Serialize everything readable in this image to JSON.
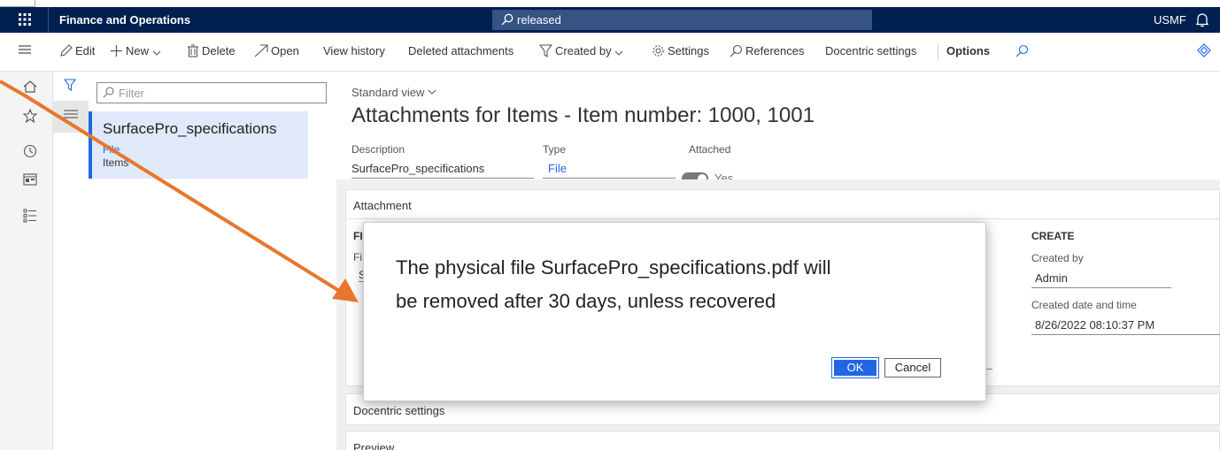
{
  "topbar": {
    "app_title": "Finance and Operations",
    "search_text": "released",
    "company": "USMF"
  },
  "actionbar": {
    "edit": "Edit",
    "new": "New",
    "delete": "Delete",
    "open": "Open",
    "view_history": "View history",
    "deleted_attachments": "Deleted attachments",
    "created_by": "Created by",
    "settings": "Settings",
    "references": "References",
    "docentric_settings": "Docentric settings",
    "options": "Options"
  },
  "list": {
    "filter_placeholder": "Filter",
    "items": [
      {
        "title": "SurfacePro_specifications",
        "type": "File",
        "table": "Items"
      }
    ]
  },
  "main": {
    "view_name": "Standard view",
    "page_title": "Attachments for Items - Item number: 1000, 1001",
    "fields": {
      "description_label": "Description",
      "description_value": "SurfacePro_specifications",
      "type_label": "Type",
      "type_value": "File",
      "attached_label": "Attached",
      "attached_value": "Yes"
    },
    "sections": {
      "attachment": "Attachment",
      "docentric": "Docentric settings",
      "preview": "Preview"
    },
    "create": {
      "heading": "CREATE",
      "created_by_label": "Created by",
      "created_by_value": "Admin",
      "created_dt_label": "Created date and time",
      "created_dt_value": "8/26/2022 08:10:37 PM"
    },
    "partial_labels": {
      "fi1": "FI",
      "fi2": "Fi",
      "s": "S"
    }
  },
  "dialog": {
    "message_line1": "The physical file SurfacePro_specifications.pdf will",
    "message_line2": "be removed after 30 days, unless recovered",
    "ok": "OK",
    "cancel": "Cancel"
  },
  "colors": {
    "topbar": "#002050",
    "accent": "#2266e3",
    "arrow": "#e8762c"
  }
}
